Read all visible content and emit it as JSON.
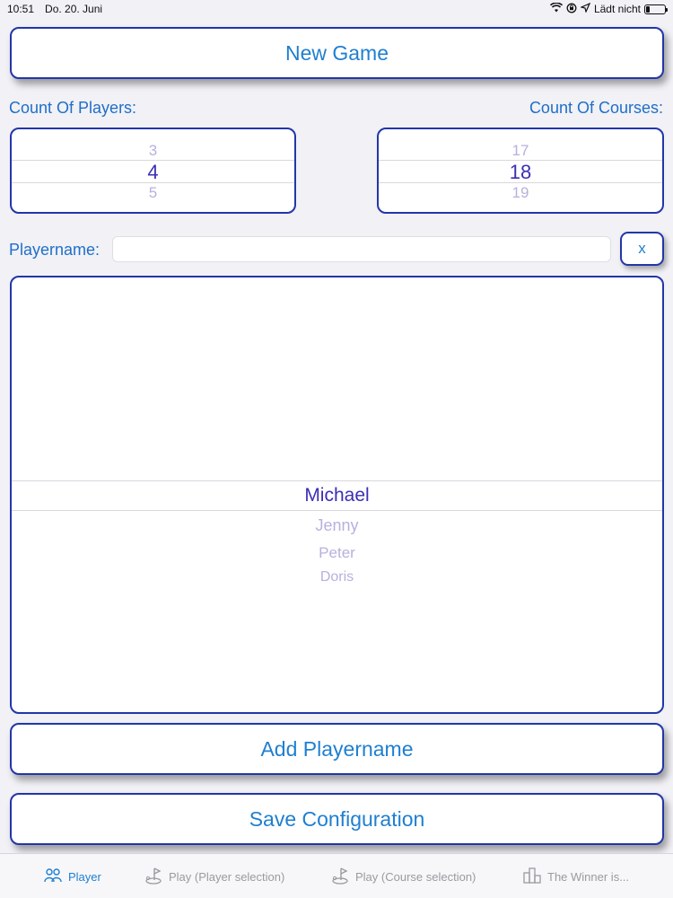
{
  "statusbar": {
    "time": "10:51",
    "date": "Do. 20. Juni",
    "charge_text": "Lädt nicht",
    "battery_level": 0.2
  },
  "new_game_label": "New Game",
  "players_picker": {
    "label": "Count Of Players:",
    "above": "3",
    "selected": "4",
    "below": "5"
  },
  "courses_picker": {
    "label": "Count Of Courses:",
    "above": "17",
    "selected": "18",
    "below": "19"
  },
  "playername": {
    "label": "Playername:",
    "value": "",
    "clear_label": "x"
  },
  "player_list": {
    "selected": "Michael",
    "others": [
      "Jenny",
      "Peter",
      "Doris"
    ]
  },
  "add_playername_label": "Add Playername",
  "save_configuration_label": "Save Configuration",
  "tabs": [
    {
      "label": "Player",
      "icon": "players-icon",
      "active": true
    },
    {
      "label": "Play (Player selection)",
      "icon": "golf-flag-icon",
      "active": false
    },
    {
      "label": "Play (Course selection)",
      "icon": "golf-flag-icon",
      "active": false
    },
    {
      "label": "The Winner is...",
      "icon": "podium-icon",
      "active": false
    }
  ],
  "colors": {
    "accent": "#1f7fd0",
    "border": "#2236a8",
    "picker_selected": "#3b2fb4",
    "picker_dim": "#b6b1de",
    "background": "#f1f1f6"
  }
}
